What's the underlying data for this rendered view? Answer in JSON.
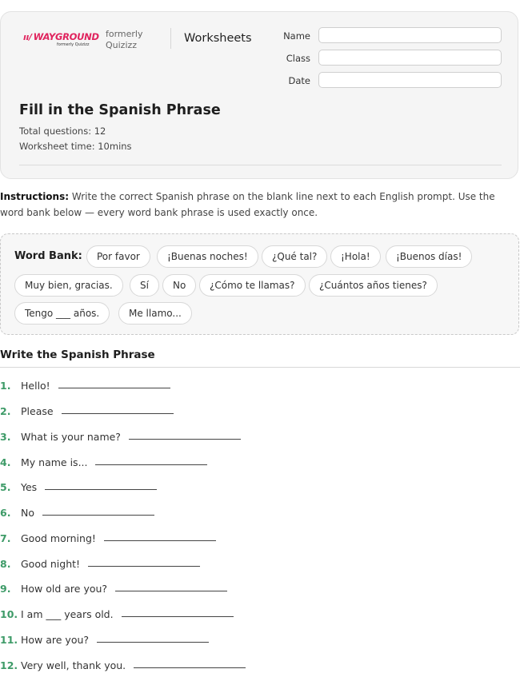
{
  "brand": {
    "logo_text": "WAYGROUND",
    "logo_subtext": "formerly Quizizz",
    "formerly_line1": "formerly",
    "formerly_line2": "Quizizz"
  },
  "header": {
    "worksheet_label": "Worksheets",
    "fields": [
      {
        "label": "Name"
      },
      {
        "label": "Class"
      },
      {
        "label": "Date"
      }
    ]
  },
  "worksheet": {
    "title": "Fill in the Spanish Phrase",
    "total_questions": "Total questions: 12",
    "time": "Worksheet time: 10mins"
  },
  "instructions": {
    "lead": "Instructions:",
    "text": " Write the correct Spanish phrase on the blank line next to each English prompt. Use the word bank below — every word bank phrase is used exactly once."
  },
  "word_bank": {
    "title": "Word Bank:",
    "items": [
      "Por favor",
      "¡Buenas noches!",
      "¿Qué tal?",
      "¡Hola!",
      "¡Buenos días!",
      "Muy bien, gracias.",
      "Sí",
      "No",
      "¿Cómo te llamas?",
      "¿Cuántos años tienes?",
      "Tengo ___ años.",
      "Me llamo..."
    ]
  },
  "section": {
    "title": "Write the Spanish Phrase"
  },
  "questions": [
    {
      "num": "1.",
      "prompt": "Hello!"
    },
    {
      "num": "2.",
      "prompt": "Please"
    },
    {
      "num": "3.",
      "prompt": "What is your name?"
    },
    {
      "num": "4.",
      "prompt": "My name is..."
    },
    {
      "num": "5.",
      "prompt": "Yes"
    },
    {
      "num": "6.",
      "prompt": "No"
    },
    {
      "num": "7.",
      "prompt": "Good morning!"
    },
    {
      "num": "8.",
      "prompt": "Good night!"
    },
    {
      "num": "9.",
      "prompt": "How old are you?"
    },
    {
      "num": "10.",
      "prompt": "I am ___ years old."
    },
    {
      "num": "11.",
      "prompt": "How are you?"
    },
    {
      "num": "12.",
      "prompt": "Very well, thank you."
    }
  ],
  "colors": {
    "brand": "#e0245e",
    "question_number": "#3e9b68"
  }
}
